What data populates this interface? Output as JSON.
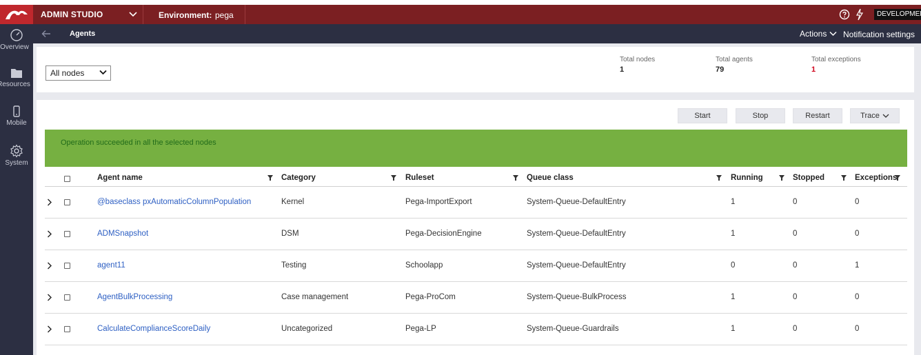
{
  "topbar": {
    "studio_label": "ADMIN STUDIO",
    "environment_label": "Environment:",
    "environment_value": "pega",
    "env_badge": "DEVELOPMENT"
  },
  "leftnav": {
    "items": [
      {
        "label": "Overview",
        "icon": "gauge-icon"
      },
      {
        "label": "Resources",
        "icon": "folder-icon"
      },
      {
        "label": "Mobile",
        "icon": "mobile-icon"
      },
      {
        "label": "System",
        "icon": "gear-icon"
      }
    ]
  },
  "subheader": {
    "title": "Agents",
    "actions_label": "Actions",
    "notification_label": "Notification settings"
  },
  "summary": {
    "node_filter": "All nodes",
    "stats": [
      {
        "label": "Total nodes",
        "value": "1"
      },
      {
        "label": "Total agents",
        "value": "79"
      },
      {
        "label": "Total exceptions",
        "value": "1"
      }
    ]
  },
  "toolbar": {
    "start_label": "Start",
    "stop_label": "Stop",
    "restart_label": "Restart",
    "trace_label": "Trace"
  },
  "banner": {
    "message": "Operation succeeded in all the selected nodes"
  },
  "table": {
    "columns": [
      "Agent name",
      "Category",
      "Ruleset",
      "Queue class",
      "Running",
      "Stopped",
      "Exceptions"
    ],
    "rows": [
      {
        "name": "@baseclass pxAutomaticColumnPopulation",
        "category": "Kernel",
        "ruleset": "Pega-ImportExport",
        "queue": "System-Queue-DefaultEntry",
        "running": "1",
        "stopped": "0",
        "exceptions": "0"
      },
      {
        "name": "ADMSnapshot",
        "category": "DSM",
        "ruleset": "Pega-DecisionEngine",
        "queue": "System-Queue-DefaultEntry",
        "running": "1",
        "stopped": "0",
        "exceptions": "0"
      },
      {
        "name": "agent11",
        "category": "Testing",
        "ruleset": "Schoolapp",
        "queue": "System-Queue-DefaultEntry",
        "running": "0",
        "stopped": "0",
        "exceptions": "1"
      },
      {
        "name": "AgentBulkProcessing",
        "category": "Case management",
        "ruleset": "Pega-ProCom",
        "queue": "System-Queue-BulkProcess",
        "running": "1",
        "stopped": "0",
        "exceptions": "0"
      },
      {
        "name": "CalculateComplianceScoreDaily",
        "category": "Uncategorized",
        "ruleset": "Pega-LP",
        "queue": "System-Queue-Guardrails",
        "running": "1",
        "stopped": "0",
        "exceptions": "0"
      }
    ]
  },
  "colors": {
    "topbar": "#7b1f22",
    "logo_bg": "#c0282d",
    "nav_bg": "#2c2f42",
    "success_banner": "#76b041",
    "link": "#2d5fc3",
    "exception_red": "#d0021b"
  }
}
